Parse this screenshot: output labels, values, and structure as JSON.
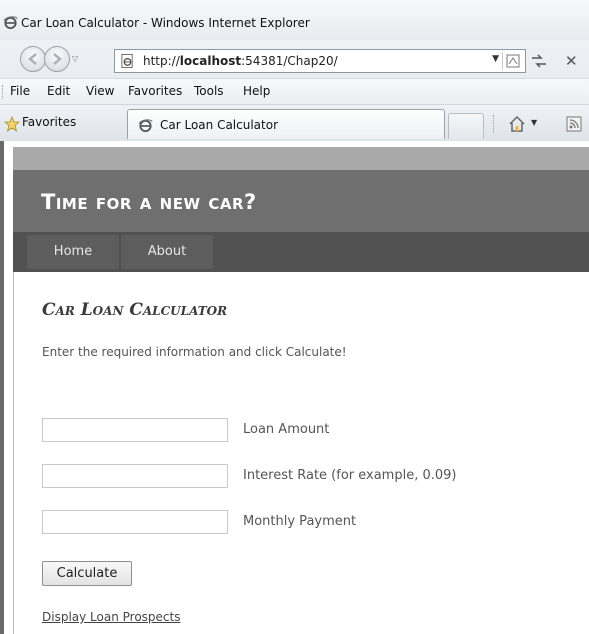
{
  "browser": {
    "window_title": "Car Loan Calculator - Windows Internet Explorer",
    "address_prefix": "http://",
    "address_host": "localhost",
    "address_rest": ":54381/Chap20/",
    "menu": [
      "File",
      "Edit",
      "View",
      "Favorites",
      "Tools",
      "Help"
    ],
    "favorites_label": "Favorites",
    "tab_title": "Car Loan Calculator"
  },
  "site": {
    "title": "Time for a new car?",
    "nav": [
      "Home",
      "About"
    ]
  },
  "main": {
    "heading": "Car Loan Calculator",
    "intro": "Enter the required information and click Calculate!",
    "fields": [
      {
        "label": "Loan Amount",
        "value": ""
      },
      {
        "label": "Interest Rate (for example, 0.09)",
        "value": ""
      },
      {
        "label": "Monthly Payment",
        "value": ""
      }
    ],
    "calculate_label": "Calculate",
    "prospects_link": "Display Loan Prospects"
  }
}
